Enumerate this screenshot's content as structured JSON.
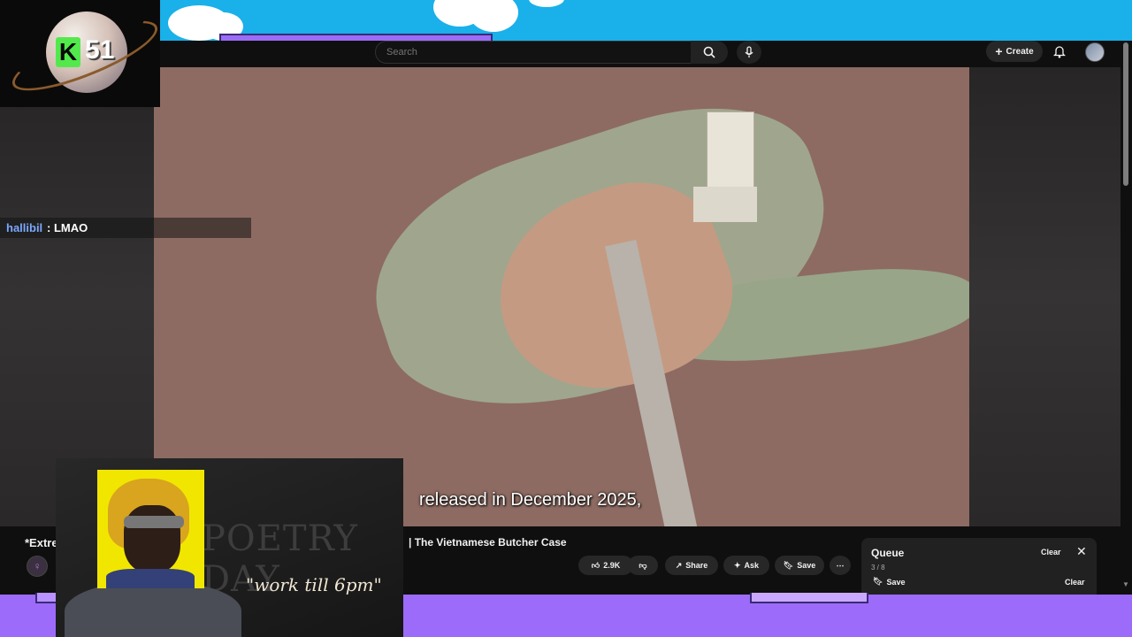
{
  "youtube": {
    "search_placeholder": "Search",
    "create_label": "Create"
  },
  "video": {
    "caption": "released in December 2025,"
  },
  "below_video": {
    "title_left": "*Extre",
    "title_right": "| The Vietnamese Butcher Case",
    "actions": {
      "like_count": "2.9K",
      "share_label": "Share",
      "ask_label": "Ask",
      "save_label": "Save"
    }
  },
  "queue": {
    "title": "Queue",
    "count": "3 / 8",
    "clear_label": "Clear",
    "save_label": "Save",
    "clear2_label": "Clear"
  },
  "overlay": {
    "logo_letter": "K",
    "logo_number": "51",
    "chat": {
      "user": "hallibil",
      "message": ": LMAO"
    },
    "board_text": "POETRY DAY",
    "quote": "\"work till 6pm\""
  },
  "icons": {
    "search": "search-icon",
    "mic": "mic-icon",
    "create": "plus-icon",
    "notifications": "bell-icon",
    "like": "thumbs-up-icon",
    "dislike": "thumbs-down-icon",
    "share": "share-icon",
    "ask": "sparkle-icon",
    "save": "bookmark-icon",
    "more": "more-icon",
    "close": "close-icon"
  },
  "colors": {
    "sky": "#1ab0ea",
    "band": "#9d6bf9",
    "youtube_bg": "#0f0f0f",
    "chat_user": "#7aa7ff",
    "logo_green": "#53e94c"
  }
}
